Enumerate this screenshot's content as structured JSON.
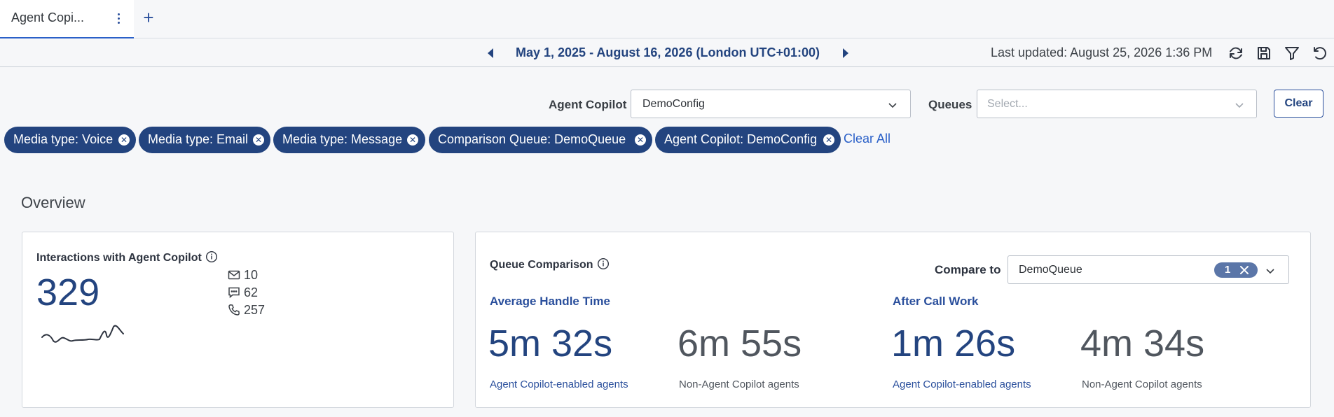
{
  "tab": {
    "label": "Agent Copi...",
    "add_label": "+"
  },
  "datebar": {
    "range": "May 1, 2025 - August 16, 2026",
    "timezone": "(London UTC+01:00)",
    "last_updated": "Last updated: August 25, 2026 1:36 PM"
  },
  "filters": {
    "agent_copilot_label": "Agent Copilot",
    "agent_copilot_value": "DemoConfig",
    "queues_label": "Queues",
    "queues_placeholder": "Select...",
    "clear_label": "Clear",
    "chips": [
      "Media type: Voice",
      "Media type: Email",
      "Media type: Message",
      "Comparison Queue: DemoQueue",
      "Agent Copilot: DemoConfig"
    ],
    "clear_all_label": "Clear All"
  },
  "overview": {
    "title": "Overview",
    "interactions": {
      "title": "Interactions with Agent Copilot",
      "count": "329",
      "email_count": "10",
      "message_count": "62",
      "voice_count": "257"
    },
    "comparison": {
      "title": "Queue Comparison",
      "compare_to_label": "Compare to",
      "compare_to_value": "DemoQueue",
      "selected_count": "1",
      "aht": {
        "title": "Average Handle Time",
        "copilot_value": "5m 32s",
        "copilot_label": "Agent Copilot-enabled agents",
        "non_copilot_value": "6m 55s",
        "non_copilot_label": "Non-Agent Copilot agents"
      },
      "acw": {
        "title": "After Call Work",
        "copilot_value": "1m 26s",
        "copilot_label": "Agent Copilot-enabled agents",
        "non_copilot_value": "4m 34s",
        "non_copilot_label": "Non-Agent Copilot agents"
      }
    }
  },
  "colors": {
    "brand": "#23447f",
    "link": "#2a60c8",
    "muted": "#50565e"
  }
}
